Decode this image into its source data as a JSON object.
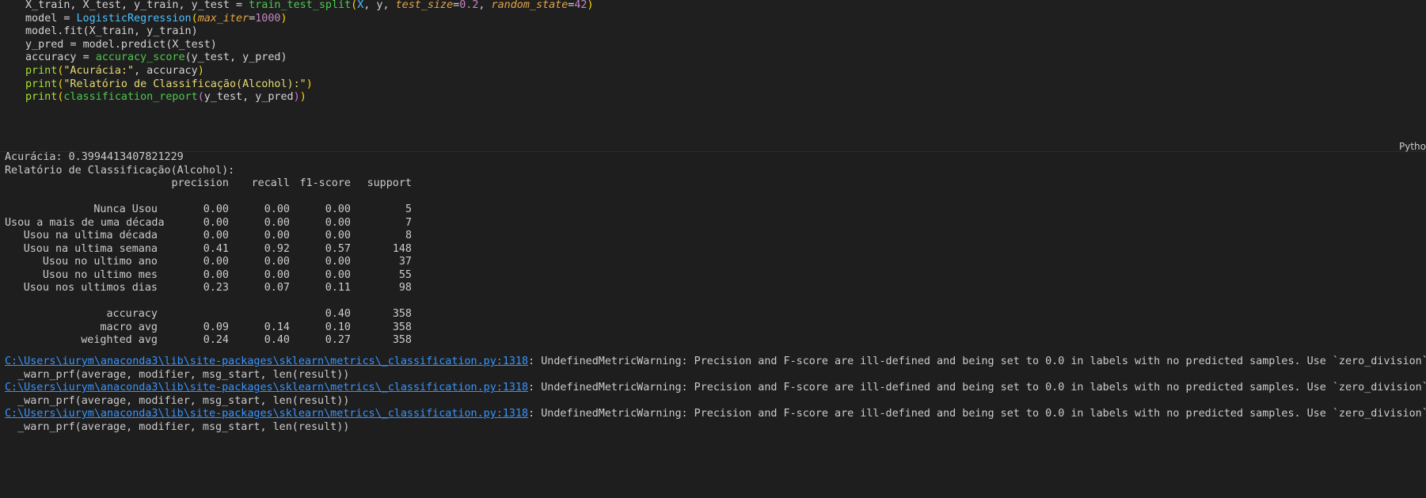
{
  "code": {
    "language_label": "Pytho",
    "lines": [
      {
        "tokens": [
          {
            "t": "X_train, X_test, y_train, y_test ",
            "c": "t-var"
          },
          {
            "t": "= ",
            "c": "t-op"
          },
          {
            "t": "train_test_split",
            "c": "t-fn"
          },
          {
            "t": "(",
            "c": "t-paren2"
          },
          {
            "t": "X",
            "c": "t-class"
          },
          {
            "t": ", y, ",
            "c": "t-var"
          },
          {
            "t": "test_size",
            "c": "t-param"
          },
          {
            "t": "=",
            "c": "t-op"
          },
          {
            "t": "0.2",
            "c": "t-num"
          },
          {
            "t": ", ",
            "c": "t-var"
          },
          {
            "t": "random_state",
            "c": "t-param"
          },
          {
            "t": "=",
            "c": "t-op"
          },
          {
            "t": "42",
            "c": "t-num"
          },
          {
            "t": ")",
            "c": "t-paren2"
          }
        ]
      },
      {
        "tokens": [
          {
            "t": "model ",
            "c": "t-var"
          },
          {
            "t": "= ",
            "c": "t-op"
          },
          {
            "t": "LogisticRegression",
            "c": "t-class"
          },
          {
            "t": "(",
            "c": "t-paren2"
          },
          {
            "t": "max_iter",
            "c": "t-param"
          },
          {
            "t": "=",
            "c": "t-op"
          },
          {
            "t": "1000",
            "c": "t-num"
          },
          {
            "t": ")",
            "c": "t-paren2"
          }
        ]
      },
      {
        "tokens": [
          {
            "t": "model.fit(X_train, y_train)",
            "c": "t-var"
          }
        ]
      },
      {
        "tokens": [
          {
            "t": "y_pred ",
            "c": "t-var"
          },
          {
            "t": "= ",
            "c": "t-op"
          },
          {
            "t": "model.predict(X_test)",
            "c": "t-var"
          }
        ]
      },
      {
        "tokens": [
          {
            "t": "accuracy ",
            "c": "t-var"
          },
          {
            "t": "= ",
            "c": "t-op"
          },
          {
            "t": "accuracy_score",
            "c": "t-fn"
          },
          {
            "t": "(y_test, y_pred)",
            "c": "t-var"
          }
        ]
      },
      {
        "tokens": [
          {
            "t": "print",
            "c": "t-builtin"
          },
          {
            "t": "(",
            "c": "t-paren2"
          },
          {
            "t": "\"Acurácia:\"",
            "c": "t-str"
          },
          {
            "t": ", accuracy",
            "c": "t-var"
          },
          {
            "t": ")",
            "c": "t-paren2"
          }
        ]
      },
      {
        "tokens": [
          {
            "t": "print",
            "c": "t-builtin"
          },
          {
            "t": "(",
            "c": "t-paren2"
          },
          {
            "t": "\"Relatório de Classificação(Alcohol):\"",
            "c": "t-str"
          },
          {
            "t": ")",
            "c": "t-paren2"
          }
        ]
      },
      {
        "tokens": [
          {
            "t": "print",
            "c": "t-builtin"
          },
          {
            "t": "(",
            "c": "t-paren2"
          },
          {
            "t": "classification_report",
            "c": "t-fn"
          },
          {
            "t": "(",
            "c": "t-paren"
          },
          {
            "t": "y_test, y_pred",
            "c": "t-var"
          },
          {
            "t": ")",
            "c": "t-paren"
          },
          {
            "t": ")",
            "c": "t-paren2"
          }
        ]
      }
    ]
  },
  "output": {
    "accuracy_line": "Acurácia: 0.3994413407821229",
    "report_title": "Relatório de Classificação(Alcohol):",
    "header": {
      "label": "",
      "precision": "precision",
      "recall": "recall",
      "f1": "f1-score",
      "support": "support"
    },
    "rows": [
      {
        "label": "Nunca Usou",
        "precision": "0.00",
        "recall": "0.00",
        "f1": "0.00",
        "support": "5"
      },
      {
        "label": "Usou a mais de uma década",
        "precision": "0.00",
        "recall": "0.00",
        "f1": "0.00",
        "support": "7"
      },
      {
        "label": "Usou na ultima década",
        "precision": "0.00",
        "recall": "0.00",
        "f1": "0.00",
        "support": "8"
      },
      {
        "label": "Usou na ultima semana",
        "precision": "0.41",
        "recall": "0.92",
        "f1": "0.57",
        "support": "148"
      },
      {
        "label": "Usou no ultimo ano",
        "precision": "0.00",
        "recall": "0.00",
        "f1": "0.00",
        "support": "37"
      },
      {
        "label": "Usou no ultimo mes",
        "precision": "0.00",
        "recall": "0.00",
        "f1": "0.00",
        "support": "55"
      },
      {
        "label": "Usou nos ultimos dias",
        "precision": "0.23",
        "recall": "0.07",
        "f1": "0.11",
        "support": "98"
      }
    ],
    "summary": [
      {
        "label": "accuracy",
        "precision": "",
        "recall": "",
        "f1": "0.40",
        "support": "358"
      },
      {
        "label": "macro avg",
        "precision": "0.09",
        "recall": "0.14",
        "f1": "0.10",
        "support": "358"
      },
      {
        "label": "weighted avg",
        "precision": "0.24",
        "recall": "0.40",
        "f1": "0.27",
        "support": "358"
      }
    ],
    "warnings": [
      {
        "link": "C:\\Users\\iurym\\anaconda3\\lib\\site-packages\\sklearn\\metrics\\_classification.py:1318",
        "message": ": UndefinedMetricWarning: Precision and F-score are ill-defined and being set to 0.0 in labels with no predicted samples. Use `zero_division` parameter",
        "trace": "  _warn_prf(average, modifier, msg_start, len(result))"
      },
      {
        "link": "C:\\Users\\iurym\\anaconda3\\lib\\site-packages\\sklearn\\metrics\\_classification.py:1318",
        "message": ": UndefinedMetricWarning: Precision and F-score are ill-defined and being set to 0.0 in labels with no predicted samples. Use `zero_division` parameter",
        "trace": "  _warn_prf(average, modifier, msg_start, len(result))"
      },
      {
        "link": "C:\\Users\\iurym\\anaconda3\\lib\\site-packages\\sklearn\\metrics\\_classification.py:1318",
        "message": ": UndefinedMetricWarning: Precision and F-score are ill-defined and being set to 0.0 in labels with no predicted samples. Use `zero_division` parameter",
        "trace": "  _warn_prf(average, modifier, msg_start, len(result))"
      }
    ]
  }
}
